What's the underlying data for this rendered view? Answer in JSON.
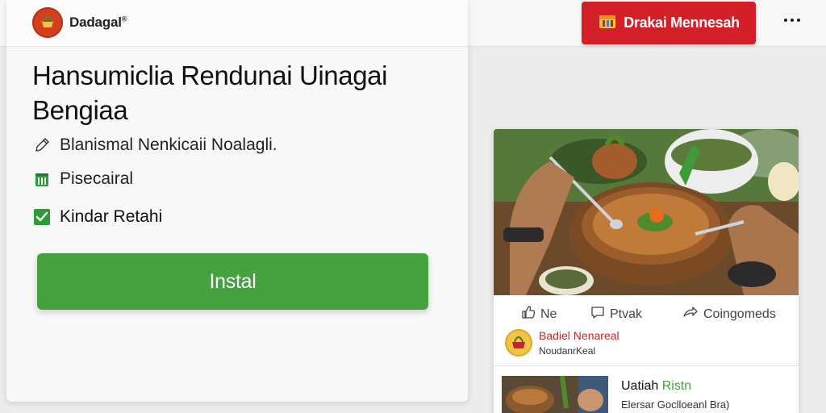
{
  "header": {
    "brand_name": "Dadagal",
    "brand_mark": "®",
    "cta_label": "Drakai Mennesah"
  },
  "main": {
    "headline": "Hansumiclia Rendunai Uinagai Bengiaa",
    "features": [
      {
        "icon": "pencil-icon",
        "label": "Blanismal Nenkicaii Noalagli."
      },
      {
        "icon": "grocery-bag-icon",
        "label": "Pisecairal"
      },
      {
        "icon": "checkbox-checked-icon",
        "label": "Kindar Retahi"
      }
    ],
    "install_label": "Instal"
  },
  "post": {
    "actions": [
      {
        "icon": "like-icon",
        "label": "Ne"
      },
      {
        "icon": "comment-icon",
        "label": "Ptvak"
      },
      {
        "icon": "share-icon",
        "label": "Coingomeds"
      }
    ],
    "author": {
      "name": "Badiel Nenareal",
      "subtitle": "NoudanrKeal"
    },
    "related": {
      "title_main": "Uatiah",
      "title_accent": "Ristn",
      "description": "Elersar Goclloeanl Bra)"
    }
  },
  "colors": {
    "cta_red": "#d32028",
    "install_green": "#43a13e",
    "author_red": "#c0262b",
    "accent_green": "#3fa23b"
  }
}
